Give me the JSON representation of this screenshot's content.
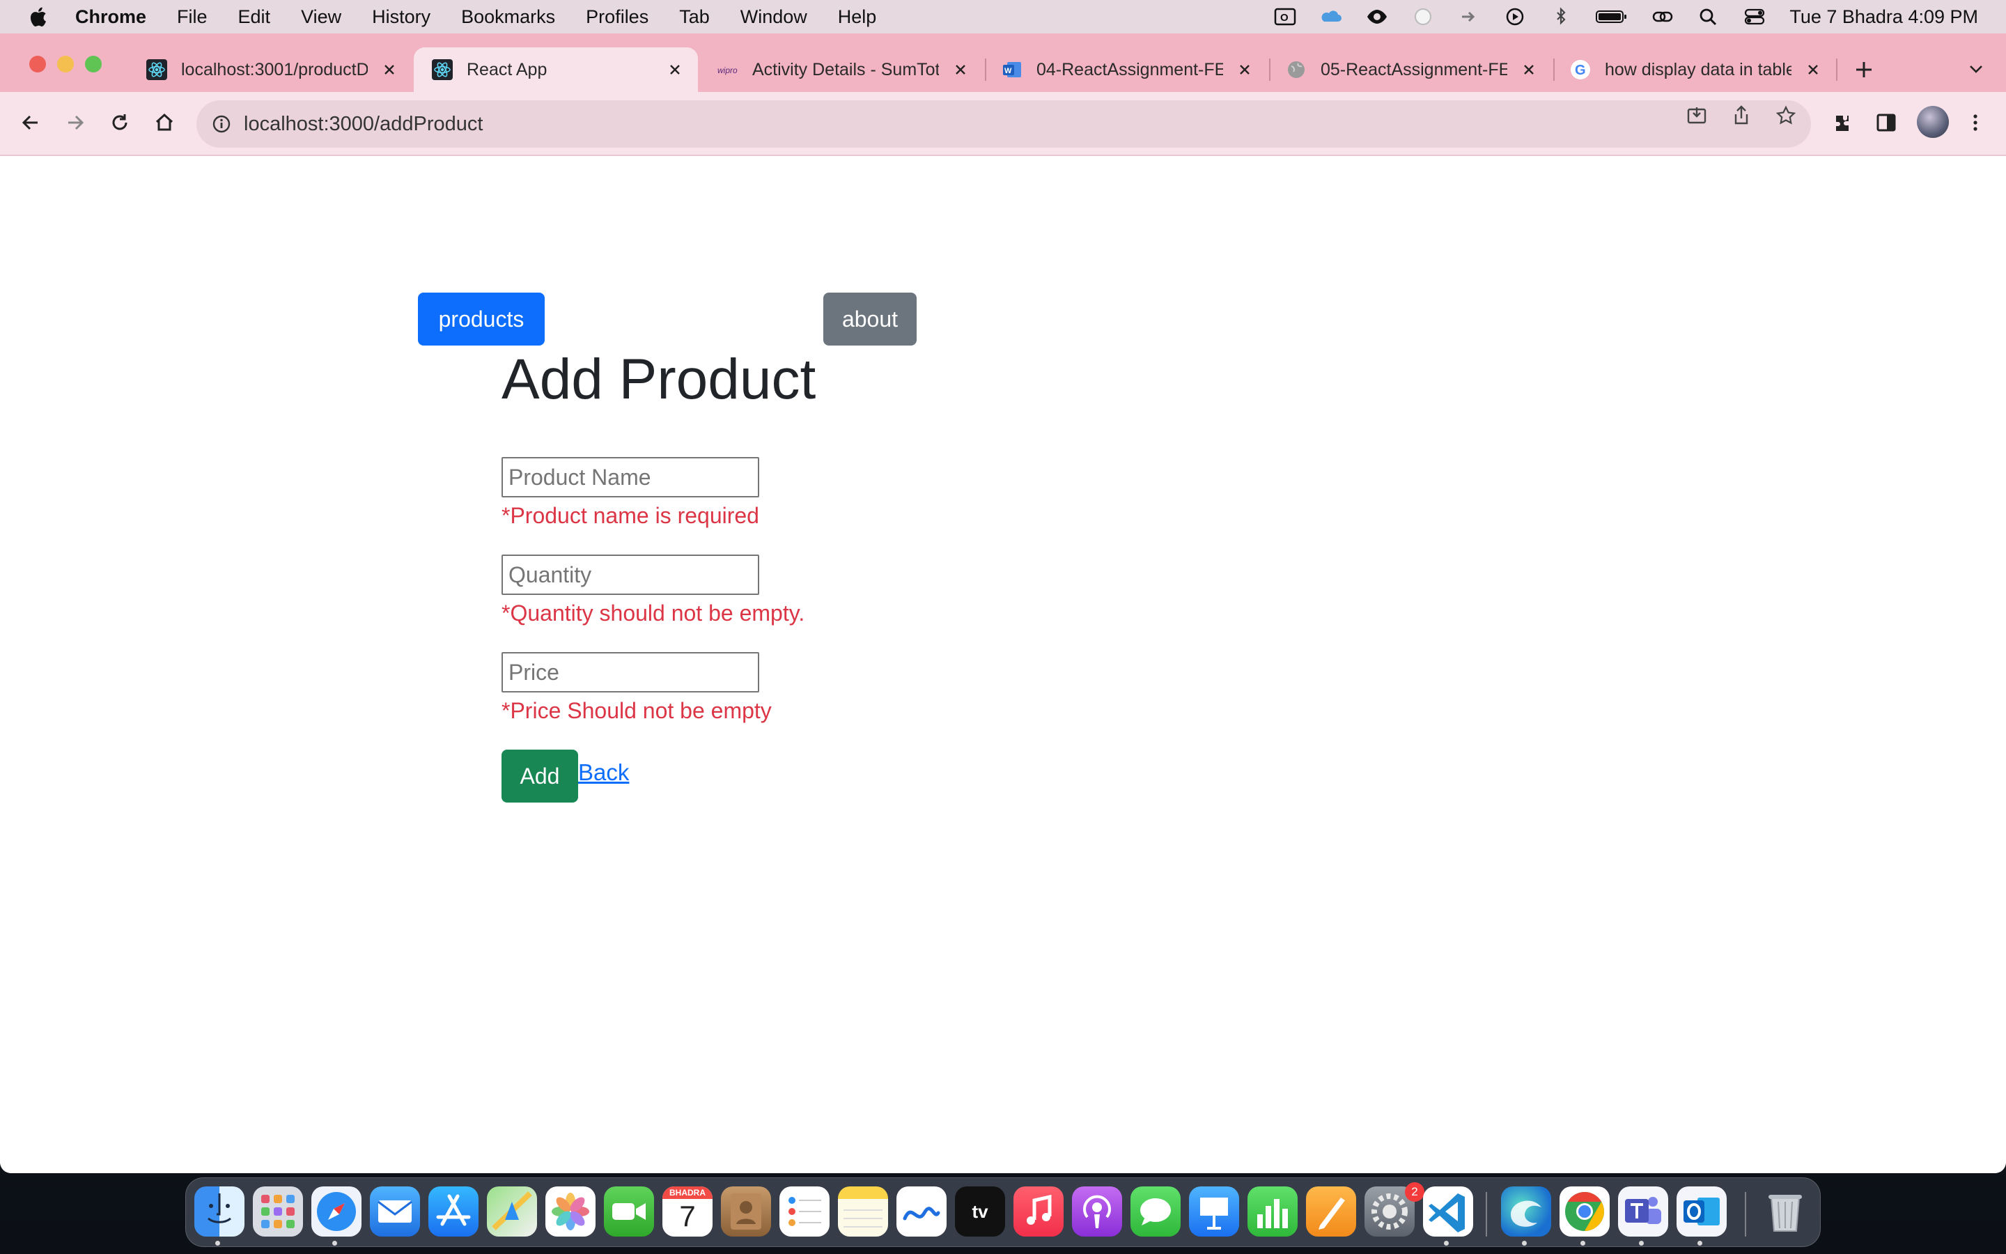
{
  "menubar": {
    "items": [
      "Chrome",
      "File",
      "Edit",
      "View",
      "History",
      "Bookmarks",
      "Profiles",
      "Tab",
      "Window",
      "Help"
    ],
    "clock": "Tue 7 Bhadra  4:09 PM"
  },
  "browser": {
    "tabs": [
      {
        "title": "localhost:3001/productD",
        "favicon": "react-icon"
      },
      {
        "title": "React App",
        "favicon": "react-icon",
        "active": true
      },
      {
        "title": "Activity Details - SumTot",
        "favicon": "wipro-icon",
        "favicon_text": "wipro"
      },
      {
        "title": "04-ReactAssignment-FE",
        "favicon": "word-icon"
      },
      {
        "title": "05-ReactAssignment-FE",
        "favicon": "globe-icon"
      },
      {
        "title": "how display data in table",
        "favicon": "google-icon"
      }
    ],
    "url": "localhost:3000/addProduct"
  },
  "page": {
    "nav": {
      "products_label": "products",
      "about_label": "about"
    },
    "title": "Add Product",
    "form": {
      "name_placeholder": "Product Name",
      "name_value": "",
      "name_error": "*Product name is required",
      "quantity_placeholder": "Quantity",
      "quantity_value": "",
      "quantity_error": "*Quantity should not be empty.",
      "price_placeholder": "Price",
      "price_value": "",
      "price_error": "*Price Should not be empty",
      "add_label": "Add",
      "back_label": "Back"
    }
  },
  "dock": {
    "calendar_month": "BHADRA",
    "calendar_day": "7",
    "appletv_label": "tv",
    "settings_badge": "2",
    "apps": [
      "finder",
      "launchpad",
      "safari",
      "mail",
      "app-store",
      "maps",
      "photos",
      "facetime",
      "calendar",
      "contacts",
      "reminders",
      "notes",
      "freeform",
      "apple-tv",
      "music",
      "podcasts",
      "messages",
      "keynote",
      "numbers",
      "pages",
      "system-settings",
      "vscode",
      "edge",
      "chrome",
      "teams",
      "outlook",
      "trash"
    ]
  },
  "colors": {
    "primary": "#0d6efd",
    "secondary": "#6c757d",
    "success": "#198754",
    "danger": "#dc3545",
    "tabstrip": "#f2b4c3",
    "toolbar": "#f9e3ea"
  }
}
